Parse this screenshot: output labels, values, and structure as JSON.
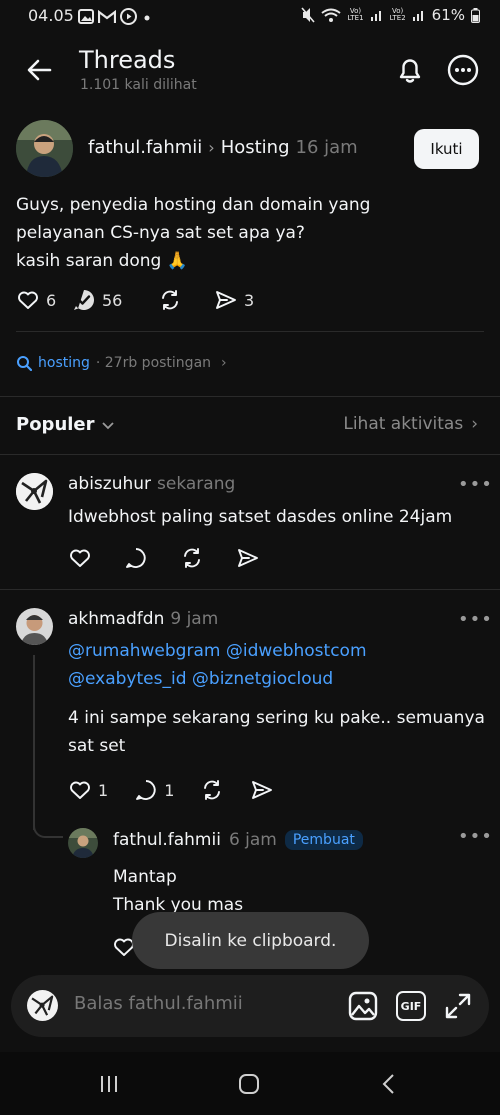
{
  "status_bar": {
    "time": "04.05",
    "network1": "Vo)\nLTE1",
    "network2": "Vo)\nLTE2",
    "battery": "61%"
  },
  "header": {
    "title": "Threads",
    "views": "1.101 kali dilihat"
  },
  "post": {
    "username": "fathul.fahmii",
    "topic": "Hosting",
    "time": "16 jam",
    "follow_label": "Ikuti",
    "text": "Guys, penyedia hosting dan domain yang\npelayanan CS-nya sat set apa ya?\nkasih saran dong 🙏",
    "likes": "6",
    "replies": "56",
    "shares": "3"
  },
  "tag": {
    "name": "hosting",
    "count": "· 27rb postingan"
  },
  "sort": {
    "label": "Populer",
    "activity_label": "Lihat aktivitas"
  },
  "replies": [
    {
      "username": "abiszuhur",
      "time": "sekarang",
      "text": "Idwebhost paling satset dasdes online 24jam"
    },
    {
      "username": "akhmadfdn",
      "time": "9 jam",
      "mention1": "@rumahwebgram",
      "mention2": "@idwebhostcom",
      "mention3": "@exabytes_id",
      "mention4": "@biznetgiocloud",
      "text": "4 ini sampe sekarang sering ku pake.. semuanya\nsat set",
      "likes": "1",
      "comments": "1"
    },
    {
      "username": "fathul.fahmii",
      "time": "6 jam",
      "badge": "Pembuat",
      "text": "Mantap\nThank you mas"
    }
  ],
  "toast": "Disalin ke clipboard.",
  "composer": {
    "placeholder": "Balas fathul.fahmii",
    "gif_label": "GIF"
  }
}
